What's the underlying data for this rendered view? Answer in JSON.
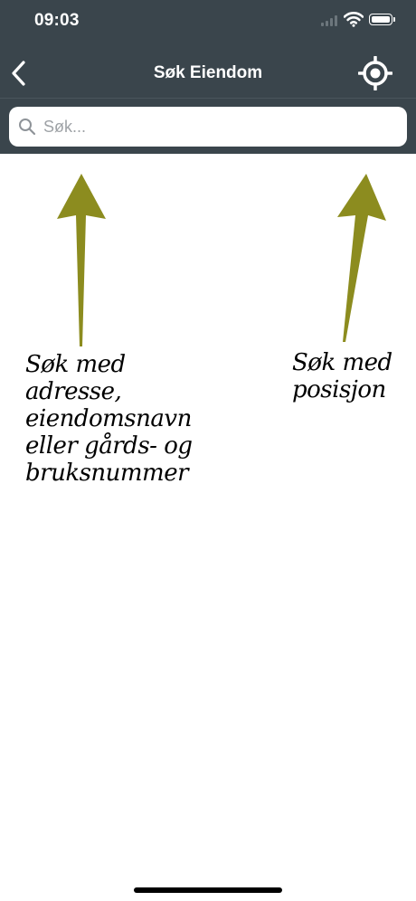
{
  "status_bar": {
    "time": "09:03"
  },
  "nav": {
    "title": "Søk Eiendom",
    "back_icon": "chevron-left-icon",
    "locate_icon": "crosshair-location-icon"
  },
  "search": {
    "placeholder": "Søk...",
    "value": ""
  },
  "annotations": {
    "left_lines": [
      "Søk med",
      "adresse,",
      "eiendomsnavn",
      "eller gårds- og",
      "bruksnummer"
    ],
    "right_lines": [
      "Søk med",
      "posisjon"
    ]
  },
  "colors": {
    "header_bg": "#3a454c",
    "arrow": "#8c8c1f"
  }
}
